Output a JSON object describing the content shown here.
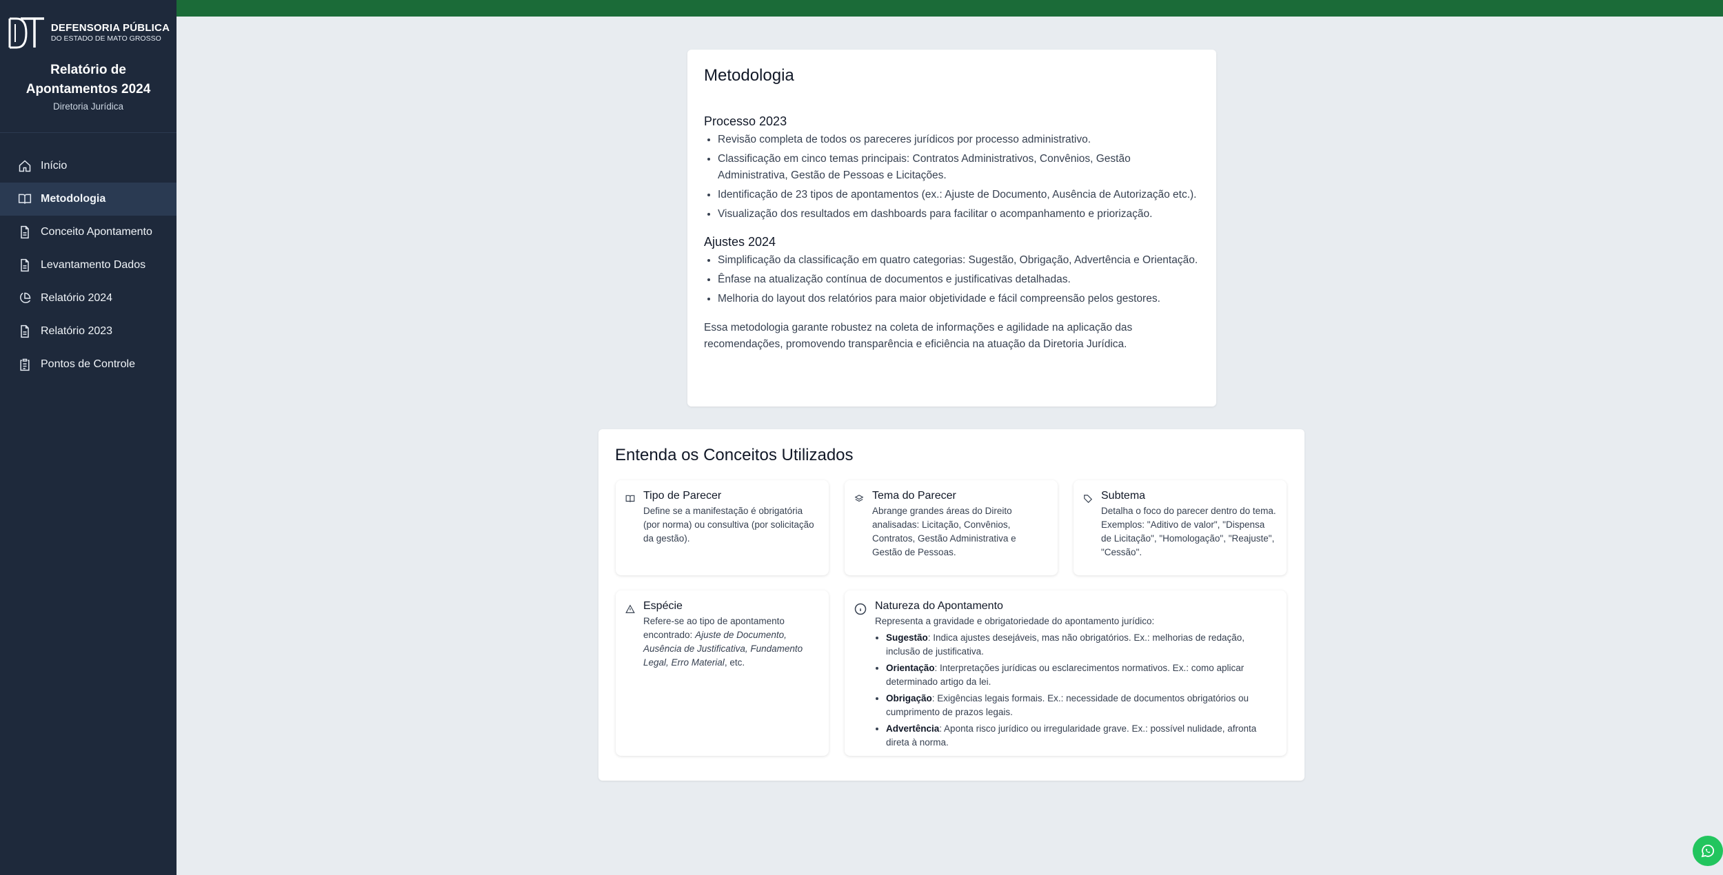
{
  "brand": {
    "logo_line1": "DEFENSORIA PÚBLICA",
    "logo_line2": "DO ESTADO DE MATO GROSSO",
    "title": "Relatório de Apontamentos 2024",
    "subtitle": "Diretoria Jurídica"
  },
  "nav": [
    {
      "label": "Início",
      "icon": "home-icon",
      "active": false
    },
    {
      "label": "Metodologia",
      "icon": "book-open-icon",
      "active": true
    },
    {
      "label": "Conceito Apontamento",
      "icon": "file-text-icon",
      "active": false
    },
    {
      "label": "Levantamento Dados",
      "icon": "file-text-icon",
      "active": false
    },
    {
      "label": "Relatório 2024",
      "icon": "pie-chart-icon",
      "active": false
    },
    {
      "label": "Relatório 2023",
      "icon": "file-text-icon",
      "active": false
    },
    {
      "label": "Pontos de Controle",
      "icon": "clipboard-icon",
      "active": false
    }
  ],
  "colors": {
    "sidebar": "#1e293b",
    "topbar": "#1b6b38",
    "background": "#e8ecf0",
    "whatsapp": "#22c55e"
  },
  "metodologia": {
    "title": "Metodologia",
    "section1_title": "Processo 2023",
    "section1_items": [
      "Revisão completa de todos os pareceres jurídicos por processo administrativo.",
      "Classificação em cinco temas principais: Contratos Administrativos, Convênios, Gestão Administrativa, Gestão de Pessoas e Licitações.",
      "Identificação de 23 tipos de apontamentos (ex.: Ajuste de Documento, Ausência de Autorização etc.).",
      "Visualização dos resultados em dashboards para facilitar o acompanhamento e priorização."
    ],
    "section2_title": "Ajustes 2024",
    "section2_items": [
      "Simplificação da classificação em quatro categorias: Sugestão, Obrigação, Advertência e Orientação.",
      "Ênfase na atualização contínua de documentos e justificativas detalhadas.",
      "Melhoria do layout dos relatórios para maior objetividade e fácil compreensão pelos gestores."
    ],
    "conclusion": "Essa metodologia garante robustez na coleta de informações e agilidade na aplicação das recomendações, promovendo transparência e eficiência na atuação da Diretoria Jurídica."
  },
  "conceitos": {
    "title": "Entenda os Conceitos Utilizados",
    "tipo": {
      "title": "Tipo de Parecer",
      "desc": "Define se a manifestação é obrigatória (por norma) ou consultiva (por solicitação da gestão).",
      "icon": "book-icon"
    },
    "tema": {
      "title": "Tema do Parecer",
      "desc": "Abrange grandes áreas do Direito analisadas: Licitação, Convênios, Contratos, Gestão Administrativa e Gestão de Pessoas.",
      "icon": "layers-icon"
    },
    "subtema": {
      "title": "Subtema",
      "desc": "Detalha o foco do parecer dentro do tema. Exemplos: \"Aditivo de valor\", \"Dispensa de Licitação\", \"Homologação\", \"Reajuste\", \"Cessão\".",
      "icon": "tag-icon"
    },
    "especie": {
      "title": "Espécie",
      "desc_prefix": "Refere-se ao tipo de apontamento encontrado: ",
      "desc_italic": "Ajuste de Documento, Ausência de Justificativa, Fundamento Legal, Erro Material",
      "desc_suffix": ", etc.",
      "icon": "alert-triangle-icon"
    },
    "natureza": {
      "title": "Natureza do Apontamento",
      "desc": "Representa a gravidade e obrigatoriedade do apontamento jurídico:",
      "icon": "info-icon",
      "items": [
        {
          "term": "Sugestão",
          "text": ": Indica ajustes desejáveis, mas não obrigatórios. Ex.: melhorias de redação, inclusão de justificativa."
        },
        {
          "term": "Orientação",
          "text": ": Interpretações jurídicas ou esclarecimentos normativos. Ex.: como aplicar determinado artigo da lei."
        },
        {
          "term": "Obrigação",
          "text": ": Exigências legais formais. Ex.: necessidade de documentos obrigatórios ou cumprimento de prazos legais."
        },
        {
          "term": "Advertência",
          "text": ": Aponta risco jurídico ou irregularidade grave. Ex.: possível nulidade, afronta direta à norma."
        }
      ]
    }
  }
}
